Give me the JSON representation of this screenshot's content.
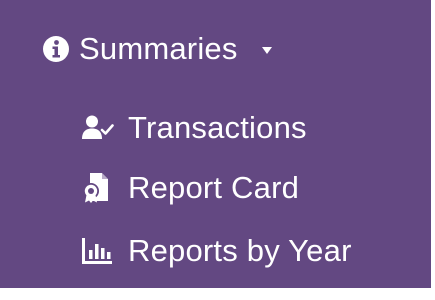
{
  "nav": {
    "background_color": "#634882",
    "text_color": "#ffffff",
    "header": {
      "icon": "info-circle-icon",
      "label": "Summaries",
      "caret_icon": "caret-down-icon"
    },
    "items": [
      {
        "icon": "user-check-icon",
        "label": "Transactions"
      },
      {
        "icon": "file-certificate-icon",
        "label": "Report Card"
      },
      {
        "icon": "bar-chart-icon",
        "label": "Reports by Year"
      }
    ]
  }
}
